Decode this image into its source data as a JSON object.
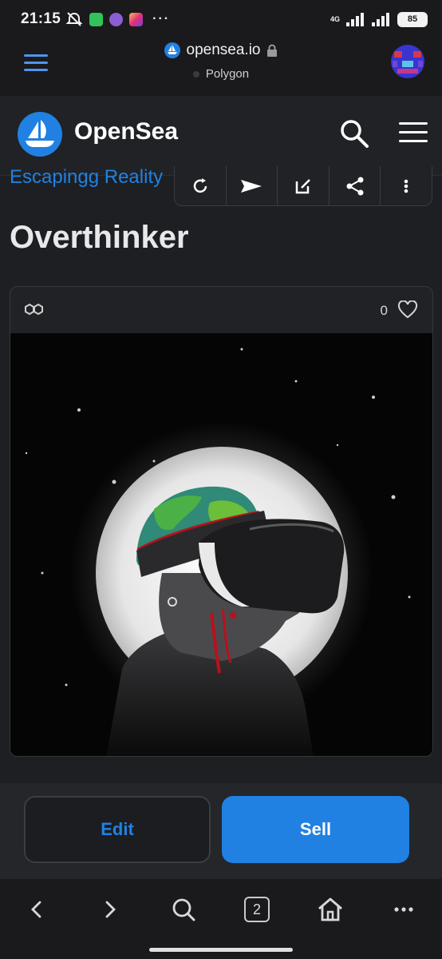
{
  "status_bar": {
    "time": "21:15",
    "network": "4G",
    "battery": "85"
  },
  "browser": {
    "domain": "opensea.io",
    "network_label": "Polygon"
  },
  "site": {
    "brand": "OpenSea"
  },
  "asset": {
    "collection": "Escapingg Reality",
    "title": "Overthinker",
    "favorites": "0"
  },
  "buttons": {
    "edit": "Edit",
    "sell": "Sell"
  },
  "navigation": {
    "tab_count": "2"
  },
  "colors": {
    "accent": "#2081e2",
    "background": "#1e1f23"
  }
}
